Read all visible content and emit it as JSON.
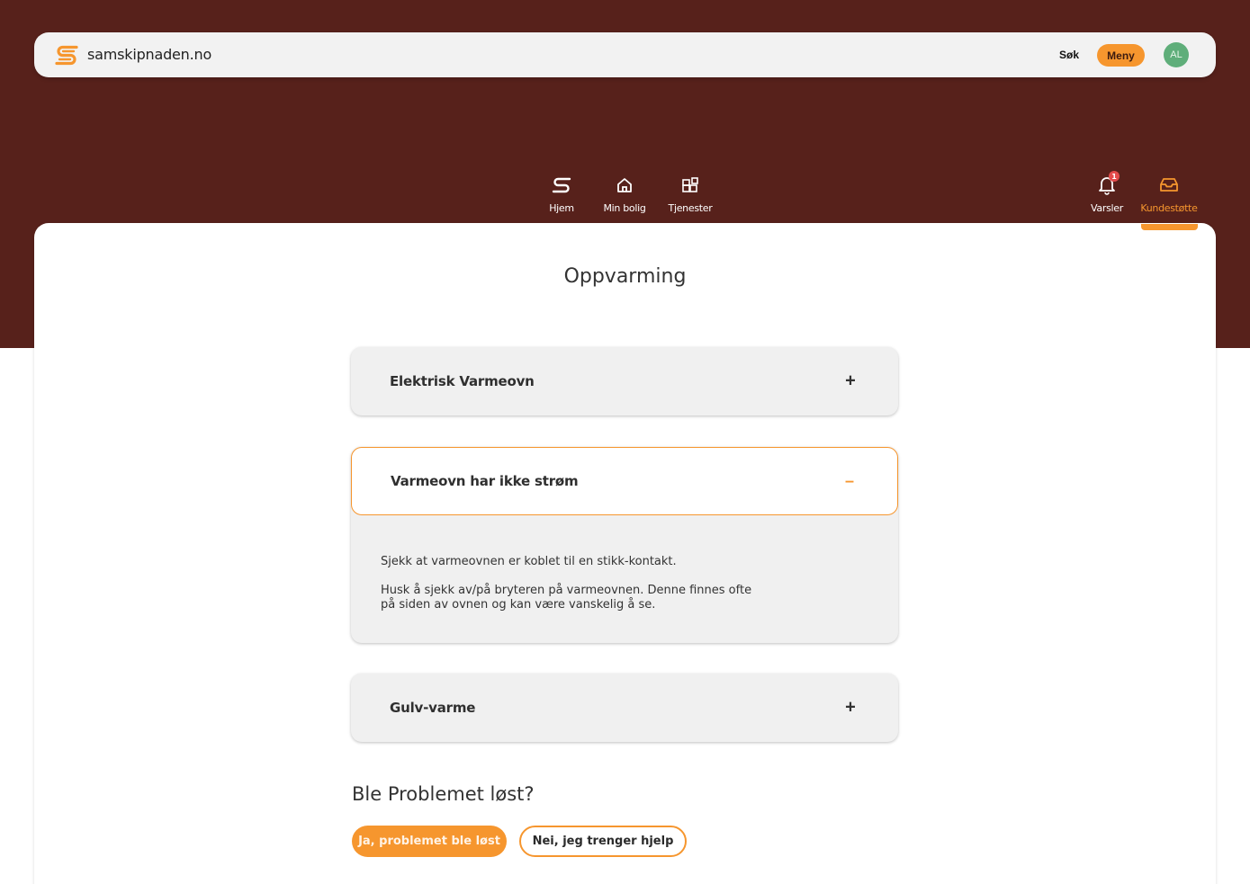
{
  "header": {
    "site_name": "samskipnaden.no",
    "search_label": "Søk",
    "menu_label": "Meny",
    "avatar_initials": "AL"
  },
  "nav": {
    "items": [
      {
        "label": "Hjem",
        "icon": "home-logo-icon"
      },
      {
        "label": "Min bolig",
        "icon": "house-icon"
      },
      {
        "label": "Tjenester",
        "icon": "services-grid-icon"
      },
      {
        "label": "Varsler",
        "icon": "bell-icon",
        "badge": "1"
      },
      {
        "label": "Kundestøtte",
        "icon": "inbox-icon",
        "active": true
      }
    ]
  },
  "main": {
    "title": "Oppvarming",
    "accordions": [
      {
        "title": "Elektrisk Varmeovn",
        "toggle": "+",
        "open": false
      },
      {
        "title": "Varmeovn har ikke strøm",
        "toggle": "–",
        "open": true,
        "body": [
          "Sjekk at varmeovnen er koblet til en stikk-kontakt.",
          "Husk å sjekk av/på bryteren på varmeovnen. Denne finnes ofte på siden av ovnen og kan være vanskelig å se."
        ]
      },
      {
        "title": "Gulv-varme",
        "toggle": "+",
        "open": false
      }
    ],
    "question": "Ble Problemet løst?",
    "yes_button": "Ja, problemet ble løst",
    "no_button": "Nei, jeg trenger hjelp"
  },
  "colors": {
    "brand_dark": "#57211b",
    "accent": "#f6962e",
    "avatar": "#5fae7a",
    "badge": "#e34b4b"
  }
}
